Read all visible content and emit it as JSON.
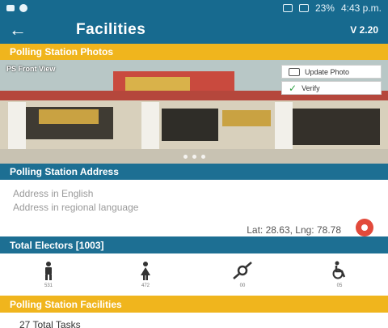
{
  "status_bar": {
    "battery": "23%",
    "time": "4:43 p.m."
  },
  "app_bar": {
    "title": "Facilities",
    "version": "V 2.20"
  },
  "photo_section": {
    "header": "Polling Station Photos",
    "photo_label": "PS Front View",
    "update_photo_label": "Update Photo",
    "verify_label": "Verify"
  },
  "address_section": {
    "header": "Polling Station Address",
    "address_english_placeholder": "Address in English",
    "address_regional_placeholder": "Address in regional language",
    "lat_lng": "Lat: 28.63, Lng: 78.78"
  },
  "electors": {
    "header": "Total Electors [1003]",
    "items": [
      {
        "icon": "male-icon",
        "count": "531"
      },
      {
        "icon": "female-icon",
        "count": "472"
      },
      {
        "icon": "third-gender-icon",
        "count": "00"
      },
      {
        "icon": "wheelchair-icon",
        "count": "05"
      }
    ]
  },
  "facilities": {
    "header": "Polling Station Facilities",
    "total_tasks": "27 Total Tasks"
  },
  "colors": {
    "primary": "#176a8f",
    "section_blue": "#1d6f93",
    "accent_yellow": "#f0b51d",
    "pin_red": "#e24a3b"
  }
}
